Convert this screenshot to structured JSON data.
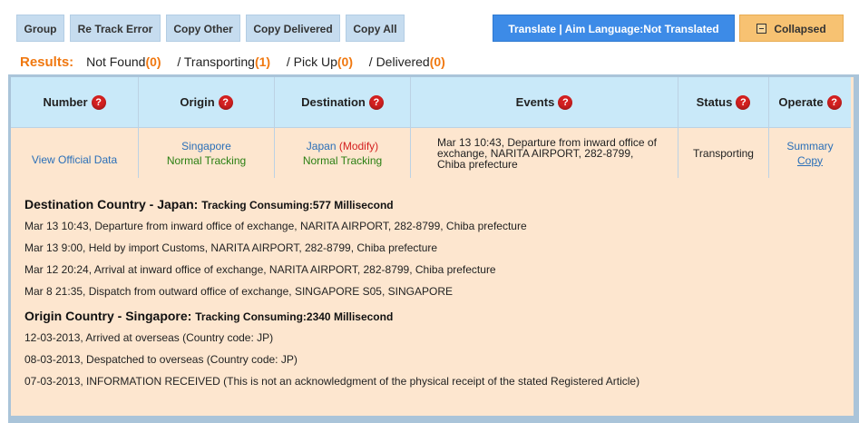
{
  "toolbar": {
    "group": "Group",
    "retrack": "Re Track Error",
    "copy_other": "Copy Other",
    "copy_delivered": "Copy Delivered",
    "copy_all": "Copy All",
    "translate": "Translate | Aim Language:Not Translated",
    "collapsed": "Collapsed"
  },
  "results": {
    "label": "Results:",
    "items": [
      {
        "label": "Not Found",
        "count": "(0)"
      },
      {
        "label": "/ Transporting",
        "count": "(1)"
      },
      {
        "label": "/ Pick Up",
        "count": "(0)"
      },
      {
        "label": "/ Delivered",
        "count": "(0)"
      }
    ]
  },
  "table": {
    "headers": [
      "Number",
      "Origin",
      "Destination",
      "Events",
      "Status",
      "Operate"
    ],
    "help_glyph": "?",
    "row": {
      "number_link": "View Official Data",
      "origin_country": "Singapore",
      "origin_tracking": "Normal Tracking",
      "dest_country": "Japan",
      "dest_modify": "(Modify)",
      "dest_tracking": "Normal Tracking",
      "events": "Mar 13 10:43, Departure from inward office of exchange, NARITA AIRPORT, 282-8799, Chiba prefecture",
      "status": "Transporting",
      "summary": "Summary",
      "copy": "Copy"
    }
  },
  "details": {
    "destination": {
      "title": "Destination Country - Japan:",
      "consuming": "Tracking Consuming:577 Millisecond",
      "events": [
        "Mar 13 10:43, Departure from inward office of exchange, NARITA AIRPORT, 282-8799, Chiba prefecture",
        "Mar 13 9:00, Held by import Customs, NARITA AIRPORT, 282-8799, Chiba prefecture",
        "Mar 12 20:24, Arrival at inward office of exchange, NARITA AIRPORT, 282-8799, Chiba prefecture",
        "Mar 8 21:35, Dispatch from outward office of exchange, SINGAPORE S05, SINGAPORE"
      ]
    },
    "origin": {
      "title": "Origin Country - Singapore:",
      "consuming": "Tracking Consuming:2340 Millisecond",
      "events": [
        "12-03-2013, Arrived at overseas (Country code: JP)",
        "08-03-2013, Despatched to overseas (Country code: JP)",
        "07-03-2013, INFORMATION RECEIVED (This is not an acknowledgment of the physical receipt of the stated Registered Article)"
      ]
    }
  },
  "colors": {
    "accent_orange": "#f07810",
    "translate_blue": "#3d8be7",
    "header_blue": "#c9e9f9",
    "body_peach": "#fde6cf",
    "help_red": "#d42020"
  }
}
